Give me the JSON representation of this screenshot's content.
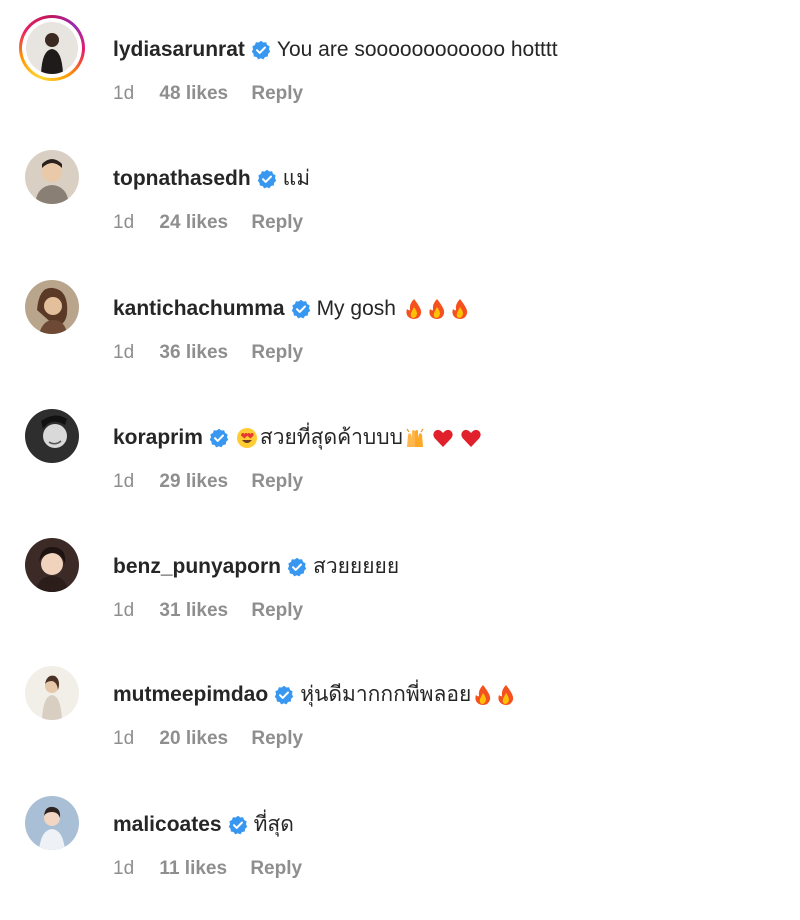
{
  "comments": [
    {
      "username": "lydiasarunrat",
      "text": "You are soooooooooooo hotttt",
      "time": "1d",
      "likes": "48 likes",
      "reply": "Reply",
      "emoji": []
    },
    {
      "username": "topnathasedh",
      "text": "แม่",
      "time": "1d",
      "likes": "24 likes",
      "reply": "Reply",
      "emoji": []
    },
    {
      "username": "kantichachumma",
      "text": "My gosh",
      "time": "1d",
      "likes": "36 likes",
      "reply": "Reply",
      "emoji": [
        "fire-emoji",
        "fire-emoji",
        "fire-emoji"
      ]
    },
    {
      "username": "koraprim",
      "text": "สวยที่สุดค้าบบบ",
      "time": "1d",
      "likes": "29 likes",
      "reply": "Reply",
      "emoji": [
        "heart-eyes-emoji",
        "raised-hands-emoji",
        "red-heart-emoji",
        "red-heart-emoji"
      ]
    },
    {
      "username": "benz_punyaporn",
      "text": "สวยยยยย",
      "time": "1d",
      "likes": "31 likes",
      "reply": "Reply",
      "emoji": []
    },
    {
      "username": "mutmeepimdao",
      "text": "หุ่นดีมากกกพี่พลอย",
      "time": "1d",
      "likes": "20 likes",
      "reply": "Reply",
      "emoji": [
        "fire-emoji",
        "fire-emoji"
      ]
    },
    {
      "username": "malicoates",
      "text": "ที่สุด",
      "time": "1d",
      "likes": "11 likes",
      "reply": "Reply",
      "emoji": []
    }
  ],
  "colors": {
    "verified": "#3897f0",
    "meta": "#8e8e8e",
    "text": "#262626"
  }
}
